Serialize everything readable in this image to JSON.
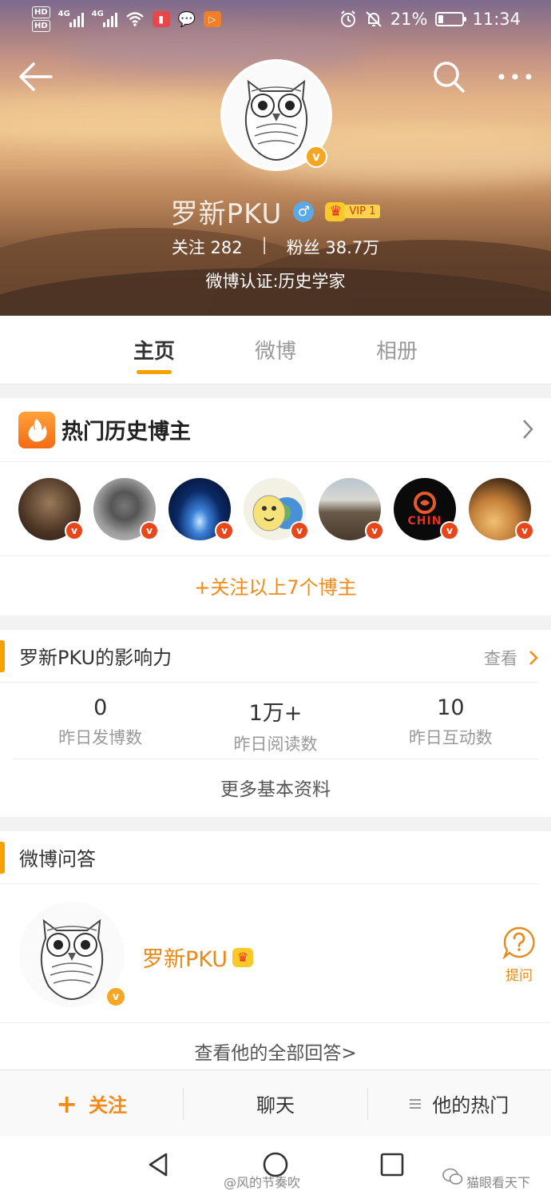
{
  "status_bar": {
    "battery": "21%",
    "time": "11:34",
    "network": [
      "4G",
      "4G"
    ],
    "hd_tags": [
      "HD",
      "HD"
    ]
  },
  "profile": {
    "name": "罗新PKU",
    "vip_label": "VIP 1",
    "following_label": "关注",
    "following_count": "282",
    "separator": "|",
    "fans_label": "粉丝",
    "fans_count": "38.7万",
    "certification": "微博认证:历史学家"
  },
  "tabs": [
    {
      "label": "主页",
      "active": true
    },
    {
      "label": "微博",
      "active": false
    },
    {
      "label": "相册",
      "active": false
    }
  ],
  "hot_bloggers": {
    "title": "热门历史博主",
    "follow_all": "+关注以上7个博主",
    "avatars": [
      {
        "name": "blogger-1"
      },
      {
        "name": "blogger-2"
      },
      {
        "name": "blogger-3"
      },
      {
        "name": "blogger-4"
      },
      {
        "name": "blogger-5"
      },
      {
        "name": "blogger-6",
        "text": "CHIN"
      },
      {
        "name": "blogger-7"
      }
    ]
  },
  "influence": {
    "title": "罗新PKU的影响力",
    "more": "查看",
    "metrics": [
      {
        "value": "0",
        "label": "昨日发博数"
      },
      {
        "value": "1万+",
        "label": "昨日阅读数"
      },
      {
        "value": "10",
        "label": "昨日互动数"
      }
    ],
    "more_info": "更多基本资料"
  },
  "qa": {
    "title": "微博问答",
    "name": "罗新PKU",
    "ask": "提问",
    "view_all": "查看他的全部回答>"
  },
  "action_bar": {
    "follow": "关注",
    "chat": "聊天",
    "hot": "他的热门"
  },
  "watermarks": {
    "left": "@风的节奏吹",
    "right": "猫眼看天下"
  },
  "colors": {
    "accent": "#f7a100",
    "orange_text": "#f28a18",
    "verify_badge": "#f5a623"
  },
  "icons": {
    "back": "arrow-left-icon",
    "search": "search-icon",
    "more": "more-dots-icon",
    "fire": "fire-icon",
    "ask": "question-bubble-icon"
  }
}
